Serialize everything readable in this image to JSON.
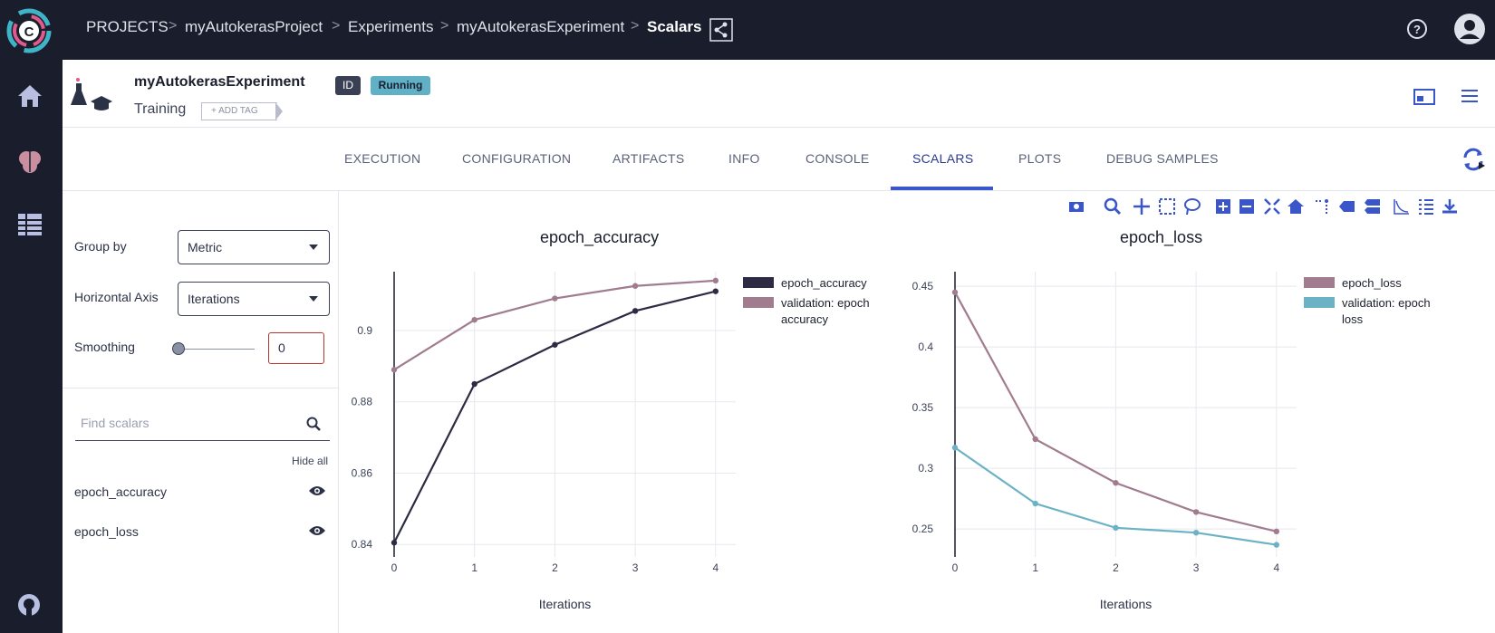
{
  "breadcrumb": {
    "items": [
      "PROJECTS",
      "myAutokerasProject",
      "Experiments",
      "myAutokerasExperiment",
      "Scalars"
    ],
    "separator": ">"
  },
  "header": {
    "title": "myAutokerasExperiment",
    "type": "Training",
    "id_badge": "ID",
    "status": "Running",
    "add_tag": "+ ADD TAG"
  },
  "tabs": [
    "EXECUTION",
    "CONFIGURATION",
    "ARTIFACTS",
    "INFO",
    "CONSOLE",
    "SCALARS",
    "PLOTS",
    "DEBUG SAMPLES"
  ],
  "active_tab": "SCALARS",
  "panel": {
    "group_by_label": "Group by",
    "group_by_value": "Metric",
    "horizontal_axis_label": "Horizontal Axis",
    "horizontal_axis_value": "Iterations",
    "smoothing_label": "Smoothing",
    "smoothing_value": "0",
    "search_placeholder": "Find scalars",
    "hide_all": "Hide all",
    "scalars": [
      "epoch_accuracy",
      "epoch_loss"
    ]
  },
  "icons": {
    "topbar": [
      "logo-icon",
      "help-icon",
      "user-avatar-icon",
      "share-icon"
    ],
    "leftnav": [
      "home-icon",
      "brain-icon",
      "table-icon",
      "github-icon"
    ],
    "plot_toolbar": [
      "camera-icon",
      "zoom-icon",
      "pan-icon",
      "box-select-icon",
      "lasso-icon",
      "zoom-in-icon",
      "zoom-out-icon",
      "autoscale-icon",
      "reset-axes-icon",
      "spike-lines-icon",
      "hover-closest-icon",
      "hover-compare-icon",
      "log-scale-icon",
      "table-view-icon",
      "download-icon"
    ]
  },
  "colors": {
    "nav_bg": "#1a1e2c",
    "accent": "#3a56c9",
    "series_train": "#2d2a44",
    "series_val_accuracy": "#a07c8e",
    "series_loss": "#a07c8e",
    "series_val_loss": "#6bb3c4"
  },
  "chart_data": [
    {
      "type": "line",
      "title": "epoch_accuracy",
      "xlabel": "Iterations",
      "ylabel": "",
      "x": [
        0,
        1,
        2,
        3,
        4
      ],
      "xlim": [
        0,
        4.25
      ],
      "ylim": [
        0.8365,
        0.9165
      ],
      "yticks": [
        0.84,
        0.86,
        0.88,
        0.9
      ],
      "ytick_labels": [
        "0.84",
        "0.86",
        "0.88",
        "0.9"
      ],
      "grid": true,
      "legend_position": "right",
      "series": [
        {
          "name": "epoch_accuracy",
          "values": [
            0.8405,
            0.885,
            0.896,
            0.9055,
            0.911
          ],
          "color": "#2d2a44"
        },
        {
          "name": "validation: epoch accuracy",
          "values": [
            0.889,
            0.903,
            0.909,
            0.9125,
            0.914
          ],
          "color": "#a07c8e"
        }
      ]
    },
    {
      "type": "line",
      "title": "epoch_loss",
      "xlabel": "Iterations",
      "ylabel": "",
      "x": [
        0,
        1,
        2,
        3,
        4
      ],
      "xlim": [
        0,
        4.25
      ],
      "ylim": [
        0.227,
        0.462
      ],
      "yticks": [
        0.25,
        0.3,
        0.35,
        0.4,
        0.45
      ],
      "ytick_labels": [
        "0.25",
        "0.3",
        "0.35",
        "0.4",
        "0.45"
      ],
      "grid": true,
      "legend_position": "right",
      "series": [
        {
          "name": "epoch_loss",
          "values": [
            0.445,
            0.324,
            0.288,
            0.264,
            0.248
          ],
          "color": "#a07c8e"
        },
        {
          "name": "validation: epoch loss",
          "values": [
            0.317,
            0.271,
            0.251,
            0.247,
            0.237
          ],
          "color": "#6bb3c4"
        }
      ]
    }
  ]
}
